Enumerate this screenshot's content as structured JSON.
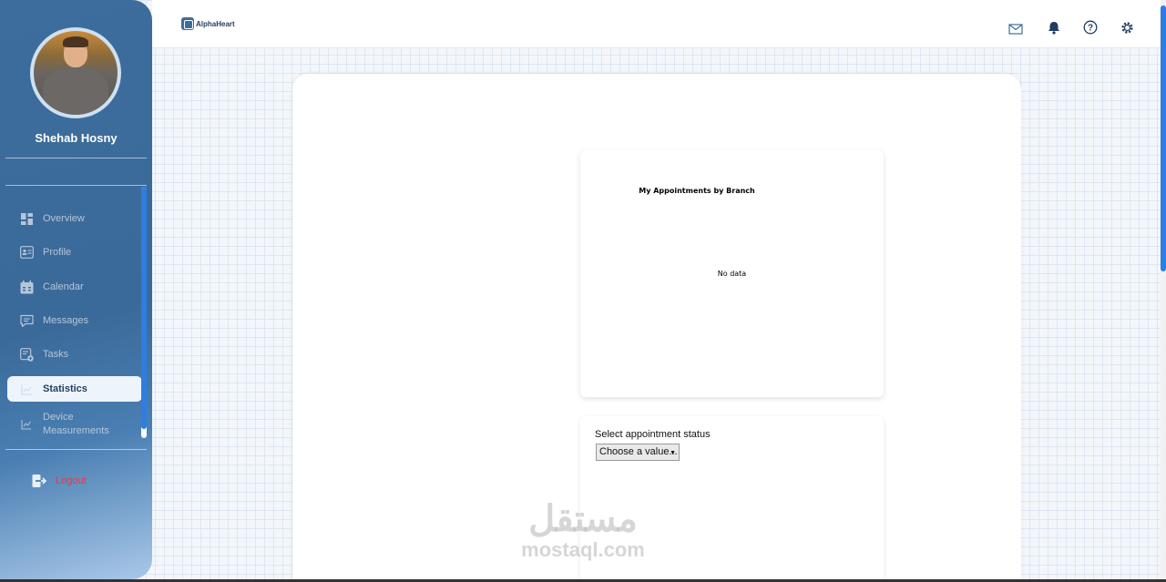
{
  "user": {
    "name": "Shehab Hosny"
  },
  "brand": {
    "name": "AlphaHeart"
  },
  "nav": {
    "items": [
      {
        "label": "Overview",
        "icon": "dashboard-icon"
      },
      {
        "label": "Profile",
        "icon": "profile-card-icon"
      },
      {
        "label": "Calendar",
        "icon": "calendar-icon"
      },
      {
        "label": "Messages",
        "icon": "message-icon"
      },
      {
        "label": "Tasks",
        "icon": "tasks-icon"
      },
      {
        "label": "Statistics",
        "icon": "chart-icon",
        "active": true
      },
      {
        "label": "Device\nMeasurements",
        "icon": "line-chart-icon"
      }
    ],
    "logout_label": "Logout"
  },
  "header_icons": [
    "mail-icon",
    "bell-icon",
    "help-icon",
    "settings-icon"
  ],
  "chart_data": {
    "type": "bar",
    "title": "My Appointments by Branch",
    "empty_message": "No data",
    "categories": [],
    "values": []
  },
  "filter": {
    "label": "Select appointment status",
    "selected": "Choose a value..."
  },
  "watermark": {
    "arabic": "مستقل",
    "latin": "mostaql.com"
  },
  "colors": {
    "sidebar": "#3d6d9c",
    "accent": "#2f7de0",
    "logout": "#e23b4a"
  }
}
